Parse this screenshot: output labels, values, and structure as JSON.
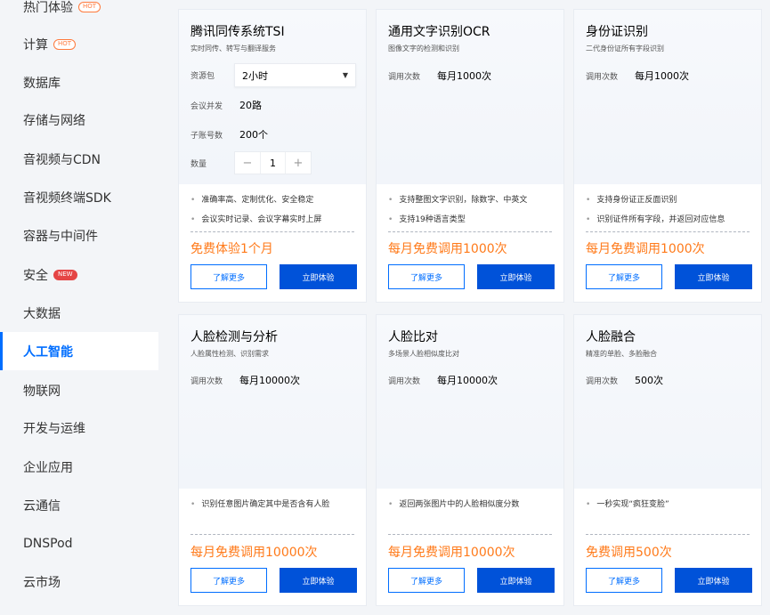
{
  "sidebar": {
    "items": [
      {
        "label": "热门体验",
        "tag": "HOT",
        "tag_type": "hot"
      },
      {
        "label": "计算",
        "tag": "HOT",
        "tag_type": "hot"
      },
      {
        "label": "数据库"
      },
      {
        "label": "存储与网络"
      },
      {
        "label": "音视频与CDN"
      },
      {
        "label": "音视频终端SDK"
      },
      {
        "label": "容器与中间件"
      },
      {
        "label": "安全",
        "tag": "NEW",
        "tag_type": "new"
      },
      {
        "label": "大数据"
      },
      {
        "label": "人工智能",
        "active": true
      },
      {
        "label": "物联网"
      },
      {
        "label": "开发与运维"
      },
      {
        "label": "企业应用"
      },
      {
        "label": "云通信"
      },
      {
        "label": "DNSPod"
      },
      {
        "label": "云市场"
      }
    ]
  },
  "cards": [
    {
      "title": "腾讯同传系统TSI",
      "subtitle": "实时同传、转写与翻译服务",
      "resource_label": "资源包",
      "resource_value": "2小时",
      "concurrency_label": "会议并发",
      "concurrency_value": "20路",
      "accounts_label": "子账号数",
      "accounts_value": "200个",
      "qty_label": "数量",
      "qty_value": "1",
      "features": [
        "准确率高、定制优化、安全稳定",
        "会议实时记录、会议字幕实时上屏"
      ],
      "price": "免费体验1个月",
      "more_label": "了解更多",
      "try_label": "立即体验"
    },
    {
      "title": "通用文字识别OCR",
      "subtitle": "图像文字的检测和识别",
      "calls_label": "调用次数",
      "calls_value": "每月1000次",
      "features": [
        "支持整图文字识别，除数字、中英文",
        "支持19种语言类型"
      ],
      "price": "每月免费调用1000次",
      "more_label": "了解更多",
      "try_label": "立即体验"
    },
    {
      "title": "身份证识别",
      "subtitle": "二代身份证所有字段识别",
      "calls_label": "调用次数",
      "calls_value": "每月1000次",
      "features": [
        "支持身份证正反面识别",
        "识别证件所有字段，并返回对应信息"
      ],
      "price": "每月免费调用1000次",
      "more_label": "了解更多",
      "try_label": "立即体验"
    },
    {
      "title": "人脸检测与分析",
      "subtitle": "人脸属性检测、识别需求",
      "calls_label": "调用次数",
      "calls_value": "每月10000次",
      "features": [
        "识别任意图片确定其中是否含有人脸"
      ],
      "price": "每月免费调用10000次",
      "more_label": "了解更多",
      "try_label": "立即体验"
    },
    {
      "title": "人脸比对",
      "subtitle": "多场景人脸相似度比对",
      "calls_label": "调用次数",
      "calls_value": "每月10000次",
      "features": [
        "返回两张图片中的人脸相似度分数"
      ],
      "price": "每月免费调用10000次",
      "more_label": "了解更多",
      "try_label": "立即体验"
    },
    {
      "title": "人脸融合",
      "subtitle": "精准的单脸、多脸融合",
      "calls_label": "调用次数",
      "calls_value": "500次",
      "features": [
        "一秒实现“疯狂变脸”"
      ],
      "price": "免费调用500次",
      "more_label": "了解更多",
      "try_label": "立即体验"
    }
  ],
  "colors": {
    "accent": "#006eff",
    "primary_button": "#0052d9",
    "price": "#ff7a1a",
    "hot_tag": "#ff7a3d",
    "new_tag": "#e54545"
  }
}
